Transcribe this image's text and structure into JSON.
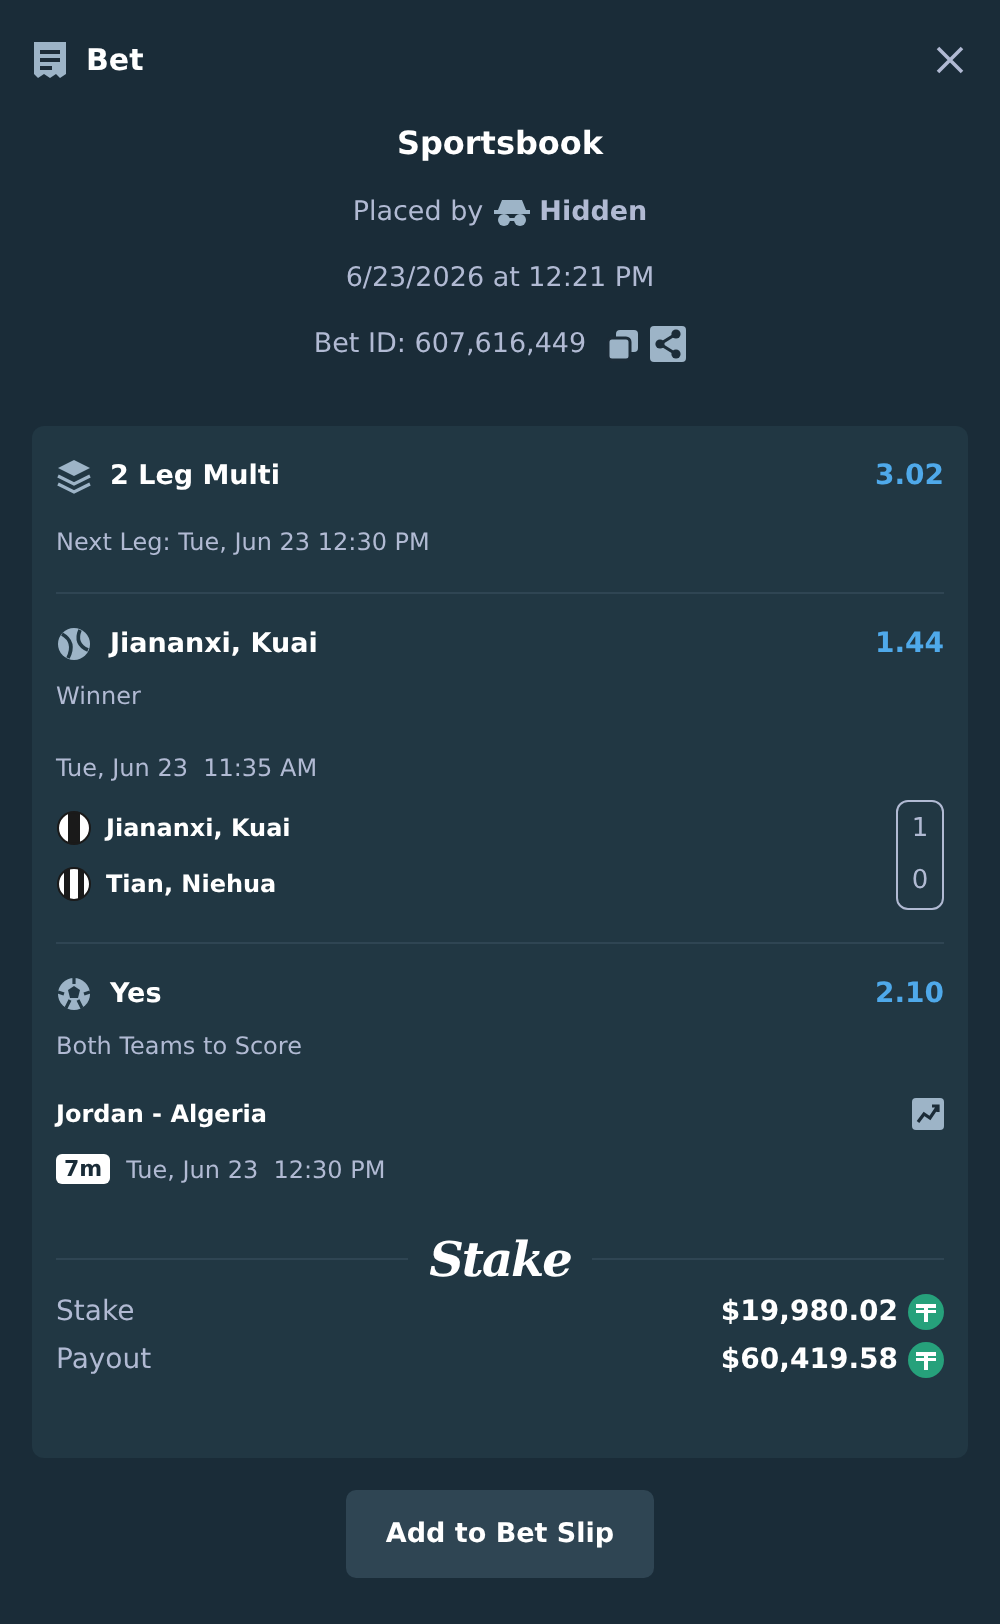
{
  "header": {
    "title": "Bet"
  },
  "summary": {
    "title": "Sportsbook",
    "placed_by_label": "Placed by",
    "placed_by_user": "Hidden",
    "date": "6/23/2026 at 12:21 PM",
    "bet_id": "Bet ID: 607,616,449"
  },
  "multi": {
    "title": "2 Leg Multi",
    "odds": "3.02",
    "next_leg": "Next Leg: Tue, Jun 23 12:30 PM"
  },
  "legs": [
    {
      "kind": "tennis",
      "selection": "Jiananxi, Kuai",
      "odds": "1.44",
      "market": "Winner",
      "time": "Tue, Jun 23  11:35 AM",
      "competitors": [
        {
          "name": "Jiananxi, Kuai",
          "score": "1"
        },
        {
          "name": "Tian, Niehua",
          "score": "0"
        }
      ]
    },
    {
      "kind": "soccer",
      "selection": "Yes",
      "odds": "2.10",
      "market": "Both Teams to Score",
      "match": "Jordan - Algeria",
      "badge": "7m",
      "time": "Tue, Jun 23  12:30 PM"
    }
  ],
  "brand": "Stake",
  "totals": [
    {
      "label": "Stake",
      "amount": "$19,980.02"
    },
    {
      "label": "Payout",
      "amount": "$60,419.58"
    }
  ],
  "action": "Add to Bet Slip"
}
